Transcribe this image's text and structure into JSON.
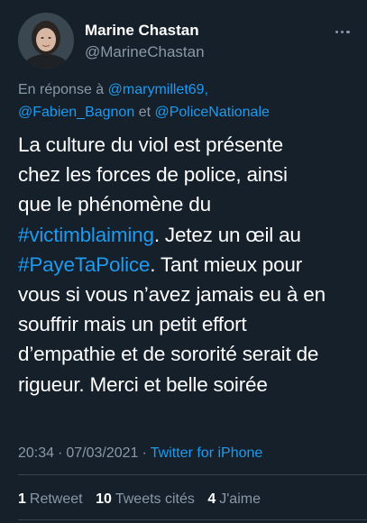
{
  "author": {
    "display_name": "Marine Chastan",
    "handle": "@MarineChastan",
    "avatar_icon": "user-photo"
  },
  "reply_to": {
    "prefix": "En réponse à",
    "user1": "@marymillet69,",
    "user2": "@Fabien_Bagnon",
    "conjunction": "et",
    "user3": "@PoliceNationale"
  },
  "tweet": {
    "line1": "La culture du viol est présente",
    "line2": "chez les forces de police, ainsi",
    "line3": "que le phénomène du",
    "hashtag1": "#victimblaiming",
    "line4_rest": ". Jetez un œil au",
    "hashtag2": "#PayeTaPolice",
    "line5_rest": ". Tant mieux pour",
    "line6": "vous si vous n’avez jamais eu à en",
    "line7": "souffrir mais un petit effort",
    "line8": "d’empathie et de sororité serait de",
    "line9": "rigueur. Merci et belle soirée"
  },
  "meta": {
    "time": "20:34",
    "date": "07/03/2021",
    "source": "Twitter for iPhone",
    "separator": "·"
  },
  "stats": {
    "retweets_count": "1",
    "retweets_label": "Retweet",
    "quotes_count": "10",
    "quotes_label": "Tweets cités",
    "likes_count": "4",
    "likes_label": "J'aime"
  },
  "colors": {
    "background": "#15202b",
    "link": "#1d9bf0",
    "secondary_text": "#8b98a5",
    "divider": "#38444d"
  }
}
